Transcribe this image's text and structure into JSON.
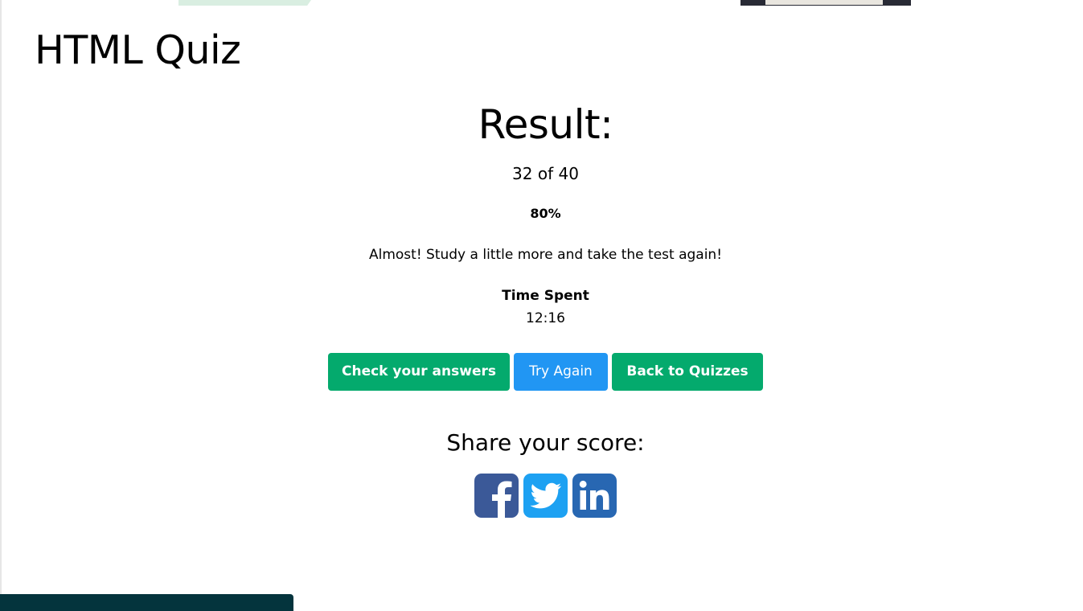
{
  "quiz": {
    "title": "HTML Quiz"
  },
  "result": {
    "heading": "Result:",
    "score": "32 of 40",
    "percent": "80%",
    "message": "Almost! Study a little more and take the test again!",
    "time_label": "Time Spent",
    "time_value": "12:16"
  },
  "actions": {
    "check_answers_label": "Check your answers",
    "try_again_label": "Try Again",
    "back_label": "Back to Quizzes"
  },
  "share": {
    "heading": "Share your score:",
    "networks": [
      {
        "name": "facebook-icon",
        "color": "#3b5998"
      },
      {
        "name": "twitter-icon",
        "color": "#1da1f2"
      },
      {
        "name": "linkedin-icon",
        "color": "#2867b2"
      }
    ]
  },
  "colors": {
    "green": "#04aa6d",
    "blue": "#2196f3",
    "dark_bar": "#04343d"
  }
}
